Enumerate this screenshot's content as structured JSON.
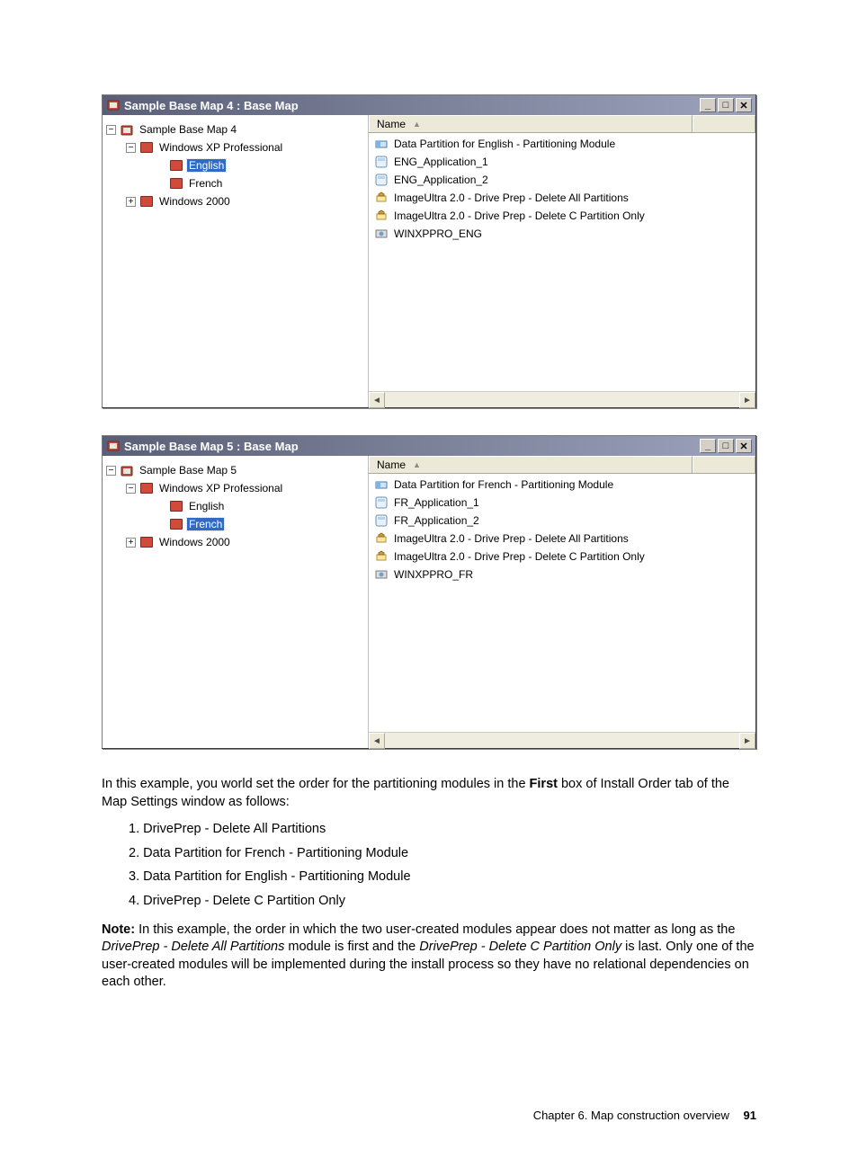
{
  "windows": [
    {
      "title": "Sample Base Map 4 : Base Map",
      "tree": {
        "root": {
          "label": "Sample Base Map 4",
          "expander": "−"
        },
        "l1": [
          {
            "label": "Windows XP Professional",
            "expander": "−",
            "children": [
              {
                "label": "English",
                "selected": true
              },
              {
                "label": "French",
                "selected": false
              }
            ]
          },
          {
            "label": "Windows 2000",
            "expander": "+"
          }
        ]
      },
      "list_header": "Name",
      "list": [
        {
          "icon": "partition",
          "label": "Data Partition for English - Partitioning Module"
        },
        {
          "icon": "app",
          "label": "ENG_Application_1"
        },
        {
          "icon": "app",
          "label": "ENG_Application_2"
        },
        {
          "icon": "prep",
          "label": "ImageUltra 2.0 - Drive Prep - Delete All Partitions"
        },
        {
          "icon": "prep",
          "label": "ImageUltra 2.0 - Drive Prep - Delete C Partition Only"
        },
        {
          "icon": "os",
          "label": "WINXPPRO_ENG"
        }
      ]
    },
    {
      "title": "Sample Base Map 5 : Base Map",
      "tree": {
        "root": {
          "label": "Sample Base Map 5",
          "expander": "−"
        },
        "l1": [
          {
            "label": "Windows XP Professional",
            "expander": "−",
            "children": [
              {
                "label": "English",
                "selected": false
              },
              {
                "label": "French",
                "selected": true
              }
            ]
          },
          {
            "label": "Windows 2000",
            "expander": "+"
          }
        ]
      },
      "list_header": "Name",
      "list": [
        {
          "icon": "partition",
          "label": "Data Partition for French - Partitioning Module"
        },
        {
          "icon": "app",
          "label": "FR_Application_1"
        },
        {
          "icon": "app",
          "label": "FR_Application_2"
        },
        {
          "icon": "prep",
          "label": "ImageUltra 2.0 - Drive Prep - Delete All Partitions"
        },
        {
          "icon": "prep",
          "label": "ImageUltra 2.0 - Drive Prep - Delete C Partition Only"
        },
        {
          "icon": "os",
          "label": "WINXPPRO_FR"
        }
      ]
    }
  ],
  "body": {
    "p1_a": "In this example, you world set the order for the partitioning modules in the ",
    "p1_bold": "First",
    "p1_b": " box of Install Order tab of the Map Settings window as follows:",
    "ordered": [
      "1.  DrivePrep - Delete All Partitions",
      "2.  Data Partition for French - Partitioning Module",
      "3.  Data Partition for English - Partitioning Module",
      "4.  DrivePrep - Delete C Partition Only"
    ],
    "note_label": "Note:",
    "note_a": " In this example, the order in which the two user-created modules appear does not matter as long as the ",
    "note_it1": "DrivePrep - Delete All Partitions",
    "note_b": " module is first and the ",
    "note_it2": "DrivePrep - Delete C Partition Only",
    "note_c": " is last. Only one of the user-created modules will be implemented during the install process so they have no relational dependencies on each other."
  },
  "footer": {
    "chapter": "Chapter 6. Map construction overview",
    "page": "91"
  },
  "glyphs": {
    "minimize": "_",
    "maximize": "□",
    "close": "✕",
    "sort_asc": "▲",
    "scroll_left": "◄",
    "scroll_right": "►"
  }
}
